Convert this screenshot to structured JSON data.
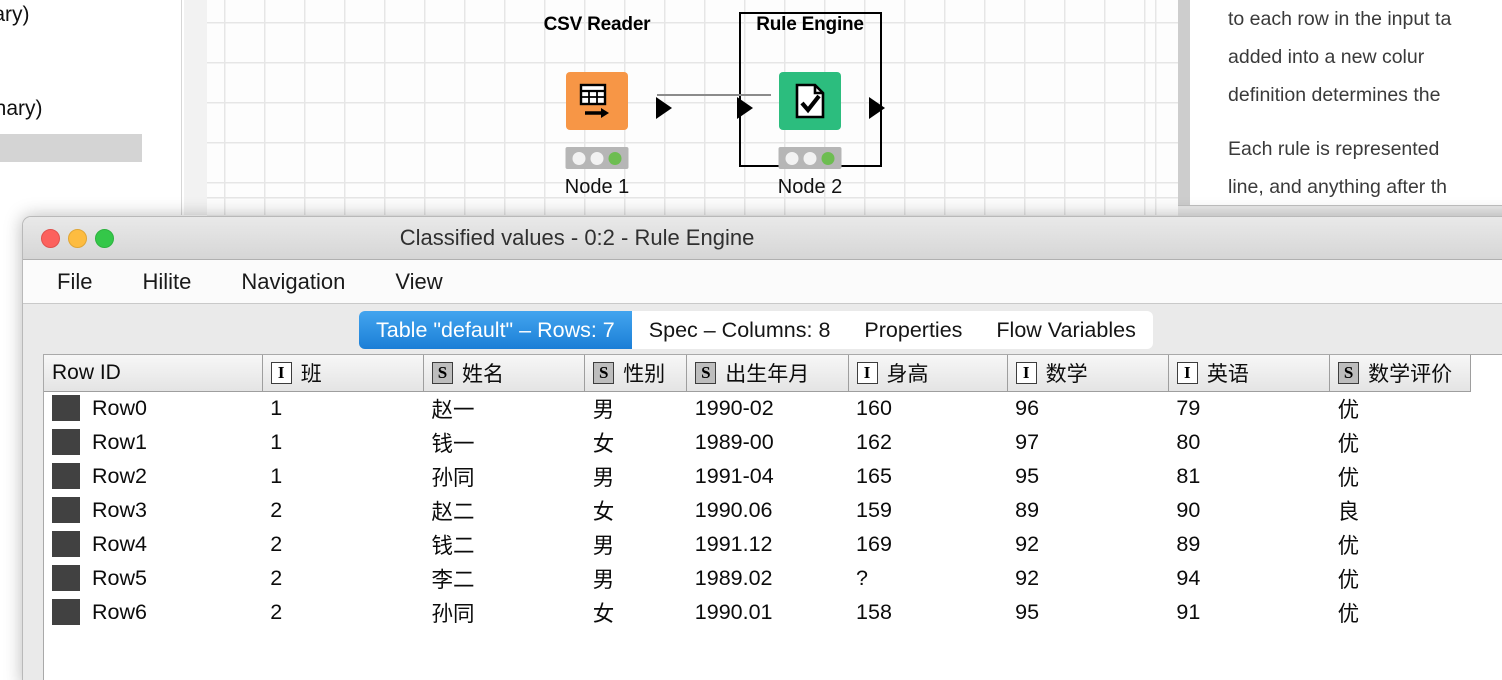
{
  "workbench": {
    "left_panel": {
      "line1": "onary)",
      "line2": "ctionary)"
    },
    "canvas": {
      "nodes": [
        {
          "title": "CSV Reader",
          "label": "Node 1",
          "icon": "csv-reader-icon",
          "color": "#f79646",
          "selected": false
        },
        {
          "title": "Rule Engine",
          "label": "Node 2",
          "icon": "rule-engine-icon",
          "color": "#2cbd7e",
          "selected": true
        }
      ]
    },
    "docs": {
      "paragraph1": [
        "to each row in the input ta",
        "added   into   a   new   colur",
        "definition determines the "
      ],
      "paragraph2": [
        "Each rule is represented ",
        "line, and anything after th"
      ]
    }
  },
  "dialog": {
    "title": "Classified values - 0:2 - Rule Engine",
    "window_controls": [
      "close",
      "minimize",
      "zoom"
    ],
    "menu": [
      "File",
      "Hilite",
      "Navigation",
      "View"
    ],
    "tabs": [
      {
        "label": "Table \"default\" – Rows: 7",
        "active": true
      },
      {
        "label": "Spec – Columns: 8",
        "active": false
      },
      {
        "label": "Properties",
        "active": false
      },
      {
        "label": "Flow Variables",
        "active": false
      }
    ],
    "table": {
      "rowid_header": "Row ID",
      "columns": [
        {
          "name": "班",
          "type": "I"
        },
        {
          "name": "姓名",
          "type": "S"
        },
        {
          "name": "性别",
          "type": "S"
        },
        {
          "name": "出生年月",
          "type": "S"
        },
        {
          "name": "身高",
          "type": "I"
        },
        {
          "name": "数学",
          "type": "I"
        },
        {
          "name": "英语",
          "type": "I"
        },
        {
          "name": "数学评价",
          "type": "S"
        }
      ],
      "rows": [
        {
          "id": "Row0",
          "cells": [
            "1",
            "赵一",
            "男",
            "1990-02",
            "160",
            "96",
            "79",
            "优"
          ]
        },
        {
          "id": "Row1",
          "cells": [
            "1",
            "钱一",
            "女",
            "1989-00",
            "162",
            "97",
            "80",
            "优"
          ]
        },
        {
          "id": "Row2",
          "cells": [
            "1",
            "孙同",
            "男",
            "1991-04",
            "165",
            "95",
            "81",
            "优"
          ]
        },
        {
          "id": "Row3",
          "cells": [
            "2",
            "赵二",
            "女",
            "1990.06",
            "159",
            "89",
            "90",
            "良"
          ]
        },
        {
          "id": "Row4",
          "cells": [
            "2",
            "钱二",
            "男",
            "1991.12",
            "169",
            "92",
            "89",
            "优"
          ]
        },
        {
          "id": "Row5",
          "cells": [
            "2",
            "李二",
            "男",
            "1989.02",
            "?",
            "92",
            "94",
            "优"
          ]
        },
        {
          "id": "Row6",
          "cells": [
            "2",
            "孙同",
            "女",
            "1990.01",
            "158",
            "95",
            "91",
            "优"
          ]
        }
      ],
      "missing_value_token": "?",
      "missing_value_color": "#e8110f"
    }
  }
}
